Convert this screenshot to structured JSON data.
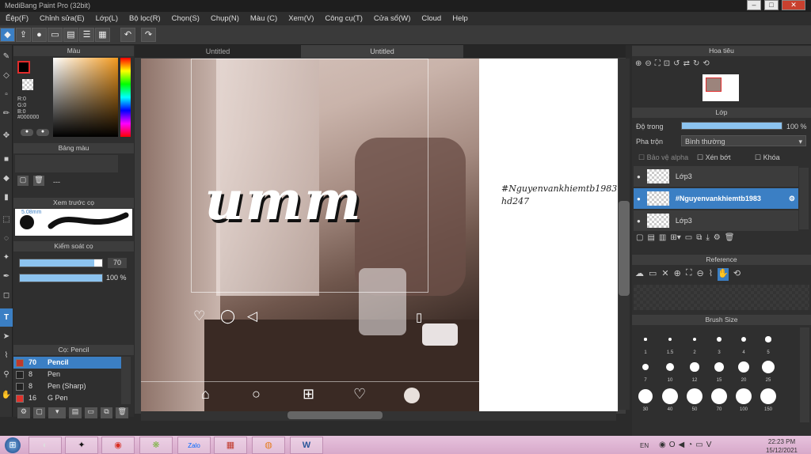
{
  "app": {
    "title": "MediBang Paint Pro (32bit)",
    "win_buttons": [
      "–",
      "□",
      "✕"
    ]
  },
  "menu": [
    "Ếệp(F)",
    "Chỉnh sửa(E)",
    "Lớp(L)",
    "Bộ lọc(R)",
    "Chọn(S)",
    "Chụp(N)",
    "Màu (C)",
    "Xem(V)",
    "Công cụ(T)",
    "Cửa sổ(W)",
    "Cloud",
    "Help"
  ],
  "toolbar_icons": [
    "bucket-icon",
    "upload-icon",
    "comment-icon",
    "chat-icon",
    "document-icon",
    "list-icon",
    "grid-icon",
    "undo-icon",
    "redo-icon"
  ],
  "color_panel": {
    "title": "Màu",
    "r": "R:0",
    "g": "G:0",
    "b": "B:0",
    "hex": "#000000"
  },
  "swatch_panel": {
    "title": "Bảng màu",
    "dash": "---"
  },
  "preview_panel": {
    "title": "Xem trước cọ",
    "size": "5.08mm"
  },
  "brush_control": {
    "title": "Kiểm soát cọ",
    "size": "70",
    "opacity": "100 %",
    "size_level": 0.9,
    "opacity_level": 1.0
  },
  "brush_list": {
    "title": "Cọ: Pencil",
    "items": [
      {
        "size": "70",
        "name": "Pencil",
        "color": "#c0392b"
      },
      {
        "size": "8",
        "name": "Pen",
        "color": "#222"
      },
      {
        "size": "8",
        "name": "Pen (Sharp)",
        "color": "#222"
      },
      {
        "size": "16",
        "name": "G Pen",
        "color": "#e0322b"
      }
    ]
  },
  "tabs": [
    "Untitled",
    "Untitled"
  ],
  "canvas": {
    "heading": "umm",
    "handwritten_1": "#Nguyenvankhiemtb1983",
    "handwritten_2": "hd247"
  },
  "navigator": {
    "title": "Hoa tiêu"
  },
  "layers": {
    "title": "Lớp",
    "opacity_label": "Độ trong",
    "opacity_value": "100 %",
    "blend_label": "Pha trộn",
    "blend_value": "Bình thường",
    "protect_alpha": "Bảo vệ alpha",
    "clip": "Xén bớt",
    "lock": "Khóa",
    "items": [
      {
        "name": "Lớp3",
        "selected": false
      },
      {
        "name": "#Nguyenvankhiemtb1983",
        "selected": true
      },
      {
        "name": "Lớp3",
        "selected": false
      }
    ]
  },
  "reference": {
    "title": "Reference"
  },
  "brush_size": {
    "title": "Brush Size",
    "row1": [
      "1",
      "1.5",
      "2",
      "3",
      "4",
      "5"
    ],
    "row2": [
      "7",
      "10",
      "12",
      "15",
      "20",
      "25"
    ],
    "row3": [
      "30",
      "40",
      "50",
      "70",
      "100",
      "150"
    ]
  },
  "taskbar": {
    "lang": "EN",
    "time": "22:23 PM",
    "date": "15/12/2021",
    "apps": [
      "Zalo",
      "W"
    ]
  }
}
